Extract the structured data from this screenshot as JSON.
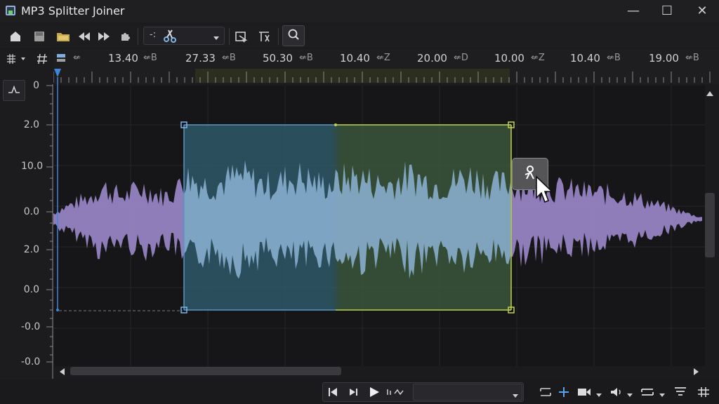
{
  "window": {
    "title": "MP3 Splitter Joiner",
    "controls": {
      "minimize": "—",
      "maximize": "☐",
      "close": "✕"
    }
  },
  "toolbar": {
    "icons": [
      "open-icon",
      "save-icon",
      "folder-icon",
      "skip-back-icon",
      "skip-forward-icon",
      "puzzle-icon",
      "cut-tool-icon",
      "select-region-icon",
      "trim-icon",
      "zoom-icon"
    ],
    "tool_select_value": "-:"
  },
  "ruler": {
    "labels": [
      {
        "time": "13.40",
        "unit": "⇍B"
      },
      {
        "time": "27.33",
        "unit": "⇍B"
      },
      {
        "time": "50.30",
        "unit": "⇍B"
      },
      {
        "time": "10.40",
        "unit": "⇍Z"
      },
      {
        "time": "20.00",
        "unit": "⇍D"
      },
      {
        "time": "10.00",
        "unit": "⇍Z"
      },
      {
        "time": "10.40",
        "unit": "⇍B"
      },
      {
        "time": "19.00",
        "unit": "⇍B"
      }
    ]
  },
  "y_axis": {
    "labels": [
      "0",
      "2.0",
      "10.0",
      "0.0",
      "2.0",
      "0.0",
      "-0.0",
      "-0.0"
    ]
  },
  "colors": {
    "waveform_outer": "#a58fd6",
    "waveform_selected": "#8db4d6",
    "selection_border_left": "#5b95c8",
    "selection_border_right": "#c0d34a",
    "selection_fill_left": "#2f5d6e",
    "selection_fill_right": "#3c5b3e",
    "playhead": "#3d86e0"
  },
  "transport": {
    "icons": [
      "skip-start-icon",
      "step-forward-icon",
      "play-icon",
      "loop-icon",
      "dropdown-icon"
    ],
    "select_value": "",
    "right_icons": [
      "tracks-icon",
      "add-marker-icon",
      "video-icon",
      "volume-icon",
      "layers-icon",
      "equalizer-icon",
      "grid-icon"
    ]
  }
}
